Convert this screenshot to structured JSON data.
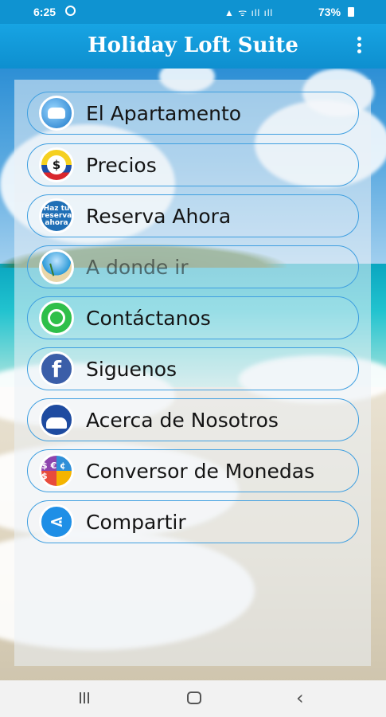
{
  "status_bar": {
    "time": "6:25",
    "battery": "73%",
    "icons": [
      "whatsapp-notification-icon",
      "alarm-icon",
      "mute-icon",
      "wifi-icon",
      "signal-icon",
      "battery-icon"
    ],
    "signal_text": "▲ ᯤ ıll ıll"
  },
  "app_bar": {
    "title": "Holiday Loft Suite",
    "overflow_icon": "more-vert-icon"
  },
  "menu": {
    "items": [
      {
        "label": "El Apartamento",
        "icon": "apartment-icon"
      },
      {
        "label": "Precios",
        "icon": "prices-icon",
        "icon_glyph": "$"
      },
      {
        "label": "Reserva Ahora",
        "icon": "book-now-icon",
        "icon_text": "Haz tu reserva ahora"
      },
      {
        "label": "A donde ir",
        "icon": "where-to-go-icon"
      },
      {
        "label": "Contáctanos",
        "icon": "whatsapp-icon"
      },
      {
        "label": "Siguenos",
        "icon": "facebook-icon",
        "icon_glyph": "f"
      },
      {
        "label": "Acerca de Nosotros",
        "icon": "about-us-icon"
      },
      {
        "label": "Conversor de Monedas",
        "icon": "currency-converter-icon",
        "icon_glyph": "$ € ¢ $"
      },
      {
        "label": "Compartir",
        "icon": "share-icon",
        "icon_glyph": "⋖"
      }
    ]
  },
  "colors": {
    "app_bar": "#0f93d1",
    "menu_border": "#3f9fe0",
    "nav_bar": "#f2f2f2"
  },
  "nav_bar": {
    "recent_icon": "recent-apps-icon",
    "home_icon": "home-icon",
    "back_icon": "back-icon",
    "back_glyph": "‹"
  }
}
